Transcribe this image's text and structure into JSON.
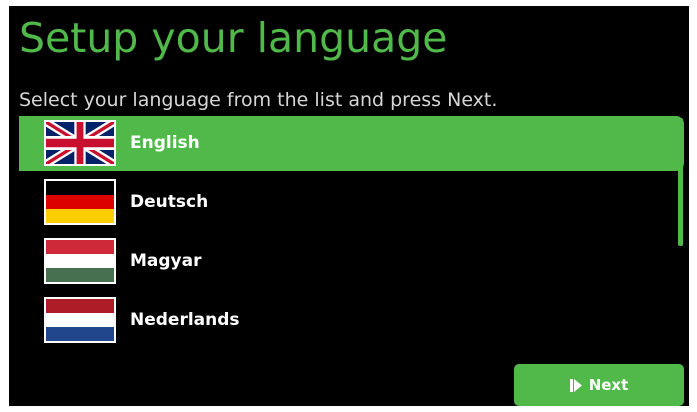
{
  "title": "Setup your language",
  "subtitle": "Select your language from the list and press Next.",
  "languages": [
    {
      "label": "English",
      "flag_icon": "uk-flag-icon",
      "selected": true
    },
    {
      "label": "Deutsch",
      "flag_icon": "germany-flag-icon",
      "selected": false
    },
    {
      "label": "Magyar",
      "flag_icon": "hungary-flag-icon",
      "selected": false
    },
    {
      "label": "Nederlands",
      "flag_icon": "netherlands-flag-icon",
      "selected": false
    }
  ],
  "next_button": {
    "label": "Next",
    "icon": "skip-next-icon"
  },
  "colors": {
    "accent": "#50b94a",
    "background": "#000000",
    "text": "#ffffff"
  }
}
